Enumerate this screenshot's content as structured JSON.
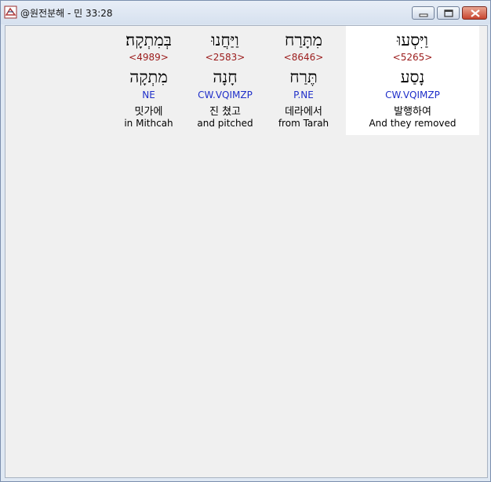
{
  "window": {
    "title": "@원전분해 - 민 33:28"
  },
  "words": [
    {
      "hebrew": "וַיִּסְעוּ",
      "strong": "<5265>",
      "lemma": "נָסַע",
      "morph": "CW.VQIMZP",
      "korean": "발행하여",
      "english": "And they removed",
      "selected": true
    },
    {
      "hebrew": "מִתָּרַח",
      "strong": "<8646>",
      "lemma": "תֶּרַח",
      "morph": "P.NE",
      "korean": "데라에서",
      "english": "from Tarah",
      "selected": false
    },
    {
      "hebrew": "וַיַּחֲנוּ",
      "strong": "<2583>",
      "lemma": "חָנָה",
      "morph": "CW.VQIMZP",
      "korean": "진 쳤고",
      "english": "and pitched",
      "selected": false
    },
    {
      "hebrew": "בְּמִתְקָה׃",
      "strong": "<4989>",
      "lemma": "מִתְקָה",
      "morph": "NE",
      "korean": "밋가에",
      "english": "in Mithcah",
      "selected": false
    }
  ],
  "colors": {
    "strong": "#9b1b1b",
    "morph": "#1f2fc9",
    "selected_bg": "#ffffff",
    "client_bg": "#f0f0f0"
  },
  "icons": {
    "app": "app-icon",
    "minimize": "minimize-icon",
    "maximize": "maximize-icon",
    "close": "close-icon"
  }
}
